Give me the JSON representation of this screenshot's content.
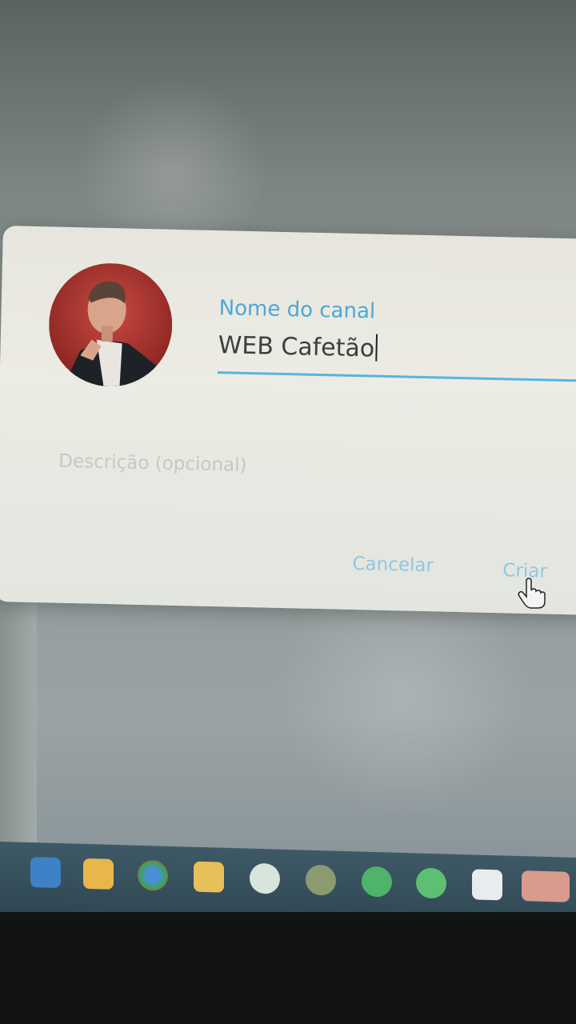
{
  "dialog": {
    "channel_name_label": "Nome do canal",
    "channel_name_value": "WEB Cafetão",
    "description_placeholder": "Descrição (opcional)",
    "cancel_label": "Cancelar",
    "create_label": "Criar"
  },
  "taskbar": {
    "icons": [
      "windows-store-icon",
      "file-explorer-icon",
      "chrome-icon",
      "briefcase-icon",
      "whatsapp-icon",
      "app-icon",
      "app-icon",
      "app-icon",
      "mail-icon",
      "app-icon"
    ]
  },
  "colors": {
    "accent": "#4ea6d6",
    "underline": "#58b4df",
    "dialog_bg": "#ecebe4",
    "taskbar_bg": "#35505c"
  }
}
